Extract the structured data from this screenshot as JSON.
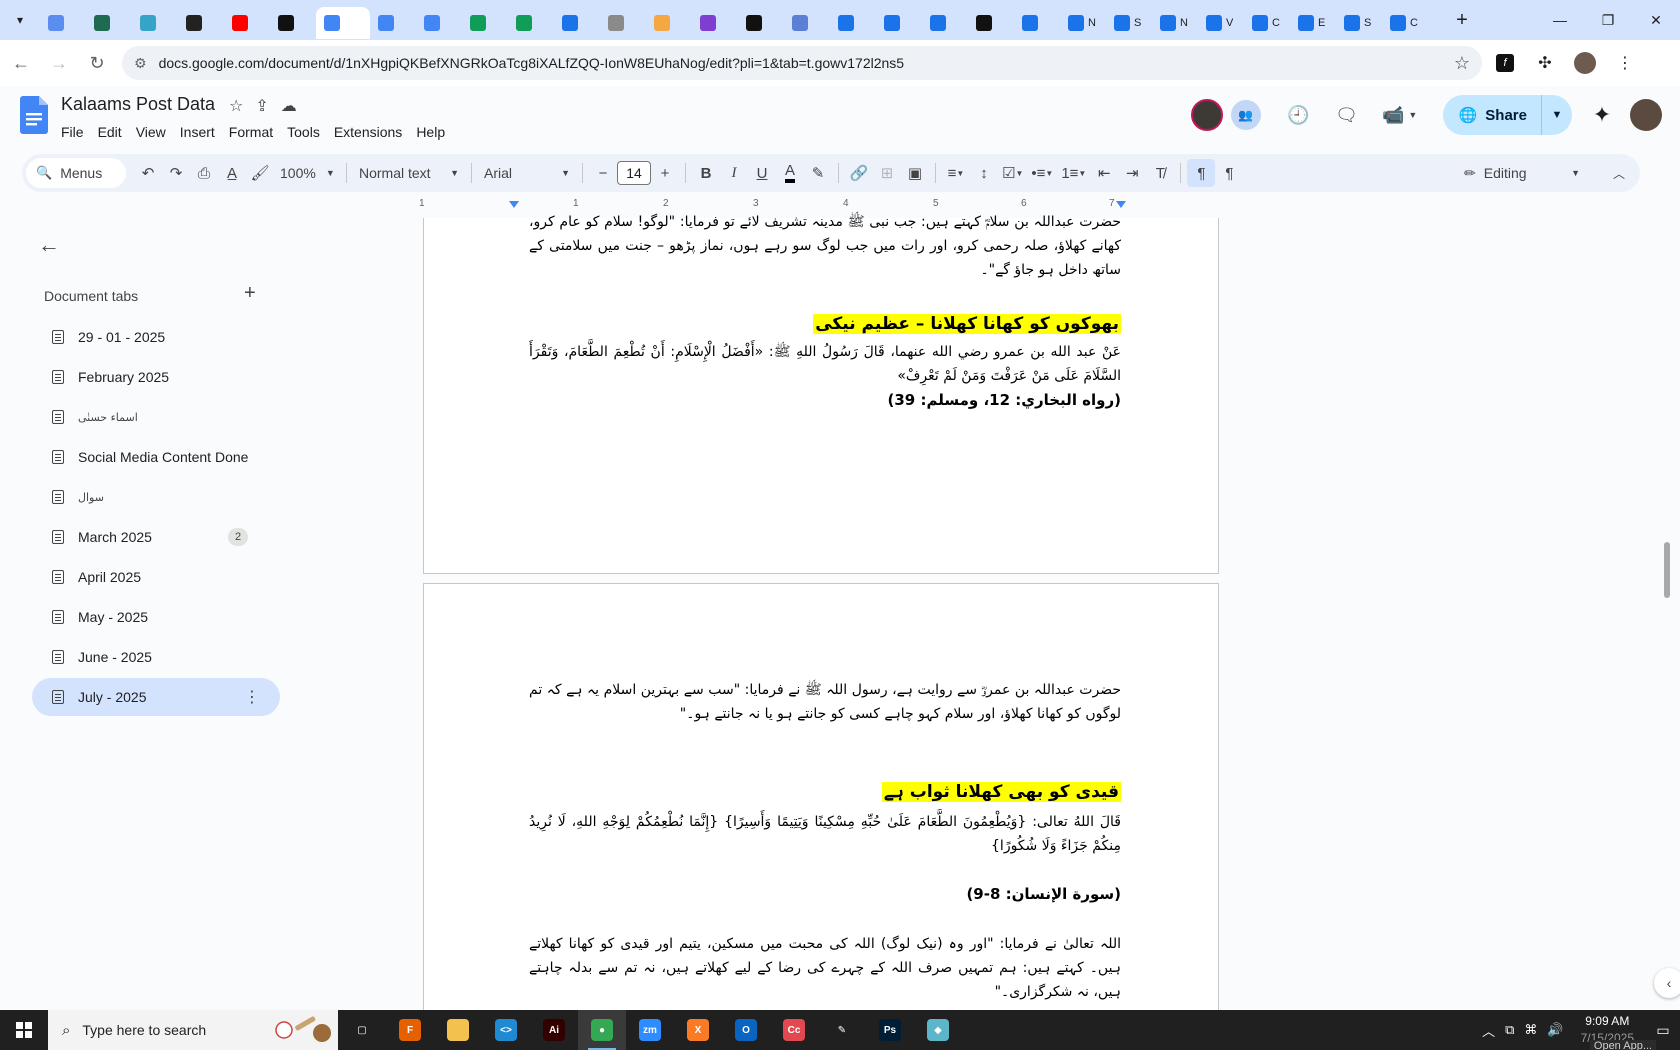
{
  "browser": {
    "tabs": [
      {
        "name": "tab-1",
        "color": "#5b8def",
        "label": ""
      },
      {
        "name": "tab-2",
        "color": "#1e6b52",
        "label": ""
      },
      {
        "name": "tab-3",
        "color": "#36a3c8",
        "label": ""
      },
      {
        "name": "tab-4",
        "color": "#222222",
        "label": ""
      },
      {
        "name": "tab-5",
        "color": "#ff0000",
        "label": ""
      },
      {
        "name": "tab-6",
        "color": "#111111",
        "label": ""
      },
      {
        "name": "tab-7",
        "color": "#4285f4",
        "label": ""
      },
      {
        "name": "tab-8",
        "color": "#4285f4",
        "label": ""
      },
      {
        "name": "tab-9",
        "color": "#4285f4",
        "label": ""
      },
      {
        "name": "tab-10",
        "color": "#0f9d58",
        "label": ""
      },
      {
        "name": "tab-11",
        "color": "#0f9d58",
        "label": ""
      },
      {
        "name": "tab-12",
        "color": "#1a73e8",
        "label": ""
      },
      {
        "name": "tab-13",
        "color": "#8a8a8a",
        "label": ""
      },
      {
        "name": "tab-14",
        "color": "#f4a742",
        "label": ""
      },
      {
        "name": "tab-15",
        "color": "#7e3fd1",
        "label": ""
      },
      {
        "name": "tab-16",
        "color": "#111111",
        "label": ""
      },
      {
        "name": "tab-17",
        "color": "#5b7fd4",
        "label": ""
      },
      {
        "name": "tab-18",
        "color": "#1a73e8",
        "label": ""
      },
      {
        "name": "tab-19",
        "color": "#1a73e8",
        "label": ""
      },
      {
        "name": "tab-20",
        "color": "#1a73e8",
        "label": ""
      },
      {
        "name": "tab-21",
        "color": "#111111",
        "label": ""
      },
      {
        "name": "tab-22",
        "color": "#1a73e8",
        "label": ""
      },
      {
        "name": "tab-23",
        "color": "#1a73e8",
        "label": "N"
      },
      {
        "name": "tab-24",
        "color": "#1a73e8",
        "label": "S"
      },
      {
        "name": "tab-25",
        "color": "#1a73e8",
        "label": "N"
      },
      {
        "name": "tab-26",
        "color": "#1a73e8",
        "label": "V"
      },
      {
        "name": "tab-27",
        "color": "#1a73e8",
        "label": "C"
      },
      {
        "name": "tab-28",
        "color": "#1a73e8",
        "label": "E"
      },
      {
        "name": "tab-29",
        "color": "#1a73e8",
        "label": "S"
      },
      {
        "name": "tab-30",
        "color": "#1a73e8",
        "label": "C"
      }
    ],
    "active_tab_index": 6,
    "new_tab_label": "+",
    "url": "docs.google.com/document/d/1nXHgpiQKBefXNGRkOaTcg8iXALfZQQ-IonW8EUhaNog/edit?pli=1&tab=t.gowv172l2ns5"
  },
  "docs": {
    "title": "Kalaams Post Data",
    "menu": [
      "File",
      "Edit",
      "View",
      "Insert",
      "Format",
      "Tools",
      "Extensions",
      "Help"
    ],
    "share_label": "Share",
    "toolbar": {
      "menus_label": "Menus",
      "zoom": "100%",
      "style": "Normal text",
      "font": "Arial",
      "font_size": "14",
      "mode": "Editing"
    },
    "ruler_ticks": [
      "1",
      "1",
      "2",
      "3",
      "4",
      "5",
      "6",
      "7"
    ]
  },
  "sidebar": {
    "heading": "Document tabs",
    "add_label": "+",
    "items": [
      {
        "label": "29 - 01 - 2025",
        "rtl": false
      },
      {
        "label": "February 2025",
        "rtl": false
      },
      {
        "label": "اسماء حسنٰی",
        "rtl": true
      },
      {
        "label": "Social Media Content Done",
        "rtl": false
      },
      {
        "label": "سوال",
        "rtl": true
      },
      {
        "label": "March 2025",
        "rtl": false,
        "badge": "2"
      },
      {
        "label": "April 2025",
        "rtl": false
      },
      {
        "label": "May - 2025",
        "rtl": false
      },
      {
        "label": "June - 2025",
        "rtl": false
      },
      {
        "label": "July - 2025",
        "rtl": false,
        "active": true
      }
    ]
  },
  "content": {
    "p1_line": "حضرت عبداللہ بن سلامؓ کہتے ہیں: جب نبی ﷺ مدینہ تشریف لائے تو فرمایا: \"لوگو! سلام کو عام کرو، کھانے کھلاؤ، صلہ رحمی کرو، اور رات میں جب لوگ سو رہے ہوں، نماز پڑھو – جنت میں سلامتی کے ساتھ داخل ہو جاؤ گے\"۔",
    "h1": "بھوکوں کو کھانا کھلانا – عظیم نیکی",
    "arabic1": "عَنْ عبد الله بن عمرو رضي الله عنهما، قَالَ رَسُولُ اللهِ ﷺ: «أَفْضَلُ الْإِسْلَامِ: أَنْ تُطْعِمَ الطَّعَامَ، وَتَقْرَأَ السَّلَامَ عَلَى مَنْ عَرَفْتَ وَمَنْ لَمْ تَعْرِفْ»",
    "ref1": "(رواه البخاري: 12، ومسلم: 39)",
    "p2": "حضرت عبداللہ بن عمروؓ سے روایت ہے، رسول اللہ ﷺ نے فرمایا: \"سب سے بہترین اسلام یہ ہے کہ تم لوگوں کو کھانا کھلاؤ، اور سلام کہو چاہے کسی کو جانتے ہو یا نہ جانتے ہو۔\"",
    "h2": "قیدی کو بھی کھلانا ثواب ہے",
    "arabic2": "قَالَ اللهُ تعالى: {وَيُطْعِمُونَ الطَّعَامَ عَلَىٰ حُبِّهِ مِسْكِينًا وَيَتِيمًا وَأَسِيرًا} {إِنَّمَا نُطْعِمُكُمْ لِوَجْهِ اللهِ، لَا نُرِيدُ مِنكُمْ جَزَاءً وَلَا شُكُورًا}",
    "ref2": "(سورة الإنسان: 8-9)",
    "p3": "اللہ تعالیٰ نے فرمایا: \"اور وہ (نیک لوگ) اللہ کی محبت میں مسکین، یتیم اور قیدی کو کھانا کھلاتے ہیں۔ کہتے ہیں: ہم تمہیں صرف اللہ کے چہرے کی رضا کے لیے کھلاتے ہیں، نہ تم سے بدلہ چاہتے ہیں، نہ شکرگزاری۔\""
  },
  "taskbar": {
    "search_placeholder": "Type here to search",
    "apps": [
      {
        "name": "task-view",
        "color": "#202020",
        "glyph": "▢"
      },
      {
        "name": "firefox",
        "color": "#e66000",
        "glyph": "F"
      },
      {
        "name": "file-explorer",
        "color": "#f2c14e",
        "glyph": ""
      },
      {
        "name": "vscode",
        "color": "#1f8ad2",
        "glyph": "<>"
      },
      {
        "name": "illustrator",
        "color": "#330000",
        "glyph": "Ai"
      },
      {
        "name": "chrome",
        "color": "#34a853",
        "glyph": "●",
        "active": true
      },
      {
        "name": "zoom",
        "color": "#2d8cff",
        "glyph": "zm"
      },
      {
        "name": "xampp",
        "color": "#fb7a24",
        "glyph": "X"
      },
      {
        "name": "outlook",
        "color": "#0a64c2",
        "glyph": "O"
      },
      {
        "name": "creative-cloud",
        "color": "#e34850",
        "glyph": "Cc"
      },
      {
        "name": "pen-tool",
        "color": "#202020",
        "glyph": "✎"
      },
      {
        "name": "photoshop",
        "color": "#001e36",
        "glyph": "Ps"
      },
      {
        "name": "app-diamond",
        "color": "#5bb6c9",
        "glyph": "◆"
      }
    ],
    "time": "9:09 AM",
    "date": "7/15/2025",
    "open_app_label": "Open App..."
  }
}
